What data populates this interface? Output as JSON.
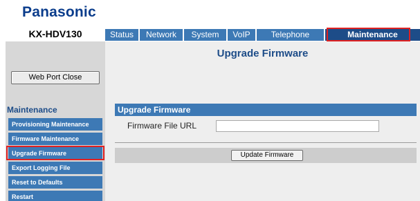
{
  "header": {
    "logo": "Panasonic",
    "model": "KX-HDV130"
  },
  "tabs": [
    {
      "label": "Status"
    },
    {
      "label": "Network"
    },
    {
      "label": "System"
    },
    {
      "label": "VoIP"
    },
    {
      "label": "Telephone"
    },
    {
      "label": "Maintenance",
      "active": true
    }
  ],
  "sidebar": {
    "web_port_close_label": "Web Port Close",
    "section_title": "Maintenance",
    "items": [
      {
        "label": "Provisioning Maintenance"
      },
      {
        "label": "Firmware Maintenance"
      },
      {
        "label": "Upgrade Firmware",
        "selected": true
      },
      {
        "label": "Export Logging File"
      },
      {
        "label": "Reset to Defaults"
      },
      {
        "label": "Restart"
      }
    ]
  },
  "main": {
    "page_title": "Upgrade Firmware",
    "section_title": "Upgrade Firmware",
    "firmware_url_label": "Firmware File URL",
    "firmware_url_value": "",
    "update_button_label": "Update Firmware"
  },
  "colors": {
    "tab_blue": "#3d79b5",
    "tab_active": "#1d4c88",
    "highlight_red": "#e02020",
    "logo_blue": "#0b3d8c"
  }
}
